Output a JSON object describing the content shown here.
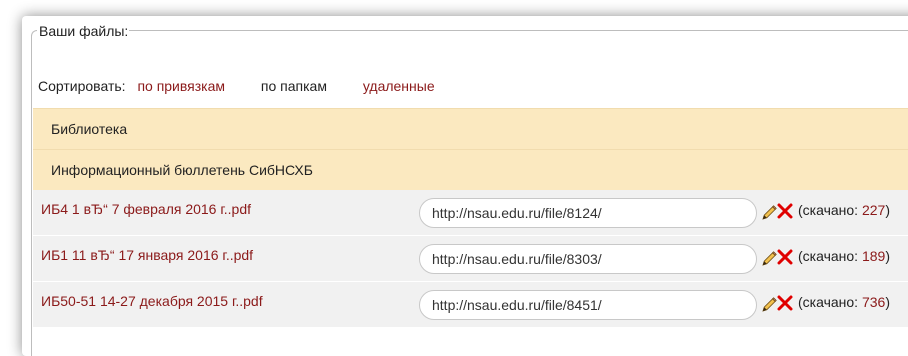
{
  "files_panel": {
    "legend": "Ваши файлы:",
    "sort": {
      "label": "Сортировать:",
      "by_links": "по привязкам",
      "by_folders": "по папкам",
      "deleted": "удаленные"
    },
    "folders": [
      {
        "label": "Библиотека"
      },
      {
        "label": "Информационный бюллетень СибНСХБ"
      }
    ],
    "files": [
      {
        "name": "ИБ4 1 вЂ“ 7 февраля 2016 г..pdf",
        "url": "http://nsau.edu.ru/file/8124/",
        "downloads_prefix": "(скачано: ",
        "downloads_count": "227",
        "downloads_suffix": ")"
      },
      {
        "name": "ИБ1 11 вЂ“ 17 января 2016 г..pdf",
        "url": "http://nsau.edu.ru/file/8303/",
        "downloads_prefix": "(скачано: ",
        "downloads_count": "189",
        "downloads_suffix": ")"
      },
      {
        "name": "ИБ50-51 14-27 декабря 2015 г..pdf",
        "url": "http://nsau.edu.ru/file/8451/",
        "downloads_prefix": "(скачано: ",
        "downloads_count": "736",
        "downloads_suffix": ")"
      }
    ],
    "icons": {
      "edit": "pencil-icon",
      "delete": "close-icon"
    },
    "colors": {
      "link": "#8b1a1a",
      "folder_bg": "#fbe9c0",
      "row_bg": "#f1f1f1",
      "delete_icon": "#e00000"
    }
  }
}
